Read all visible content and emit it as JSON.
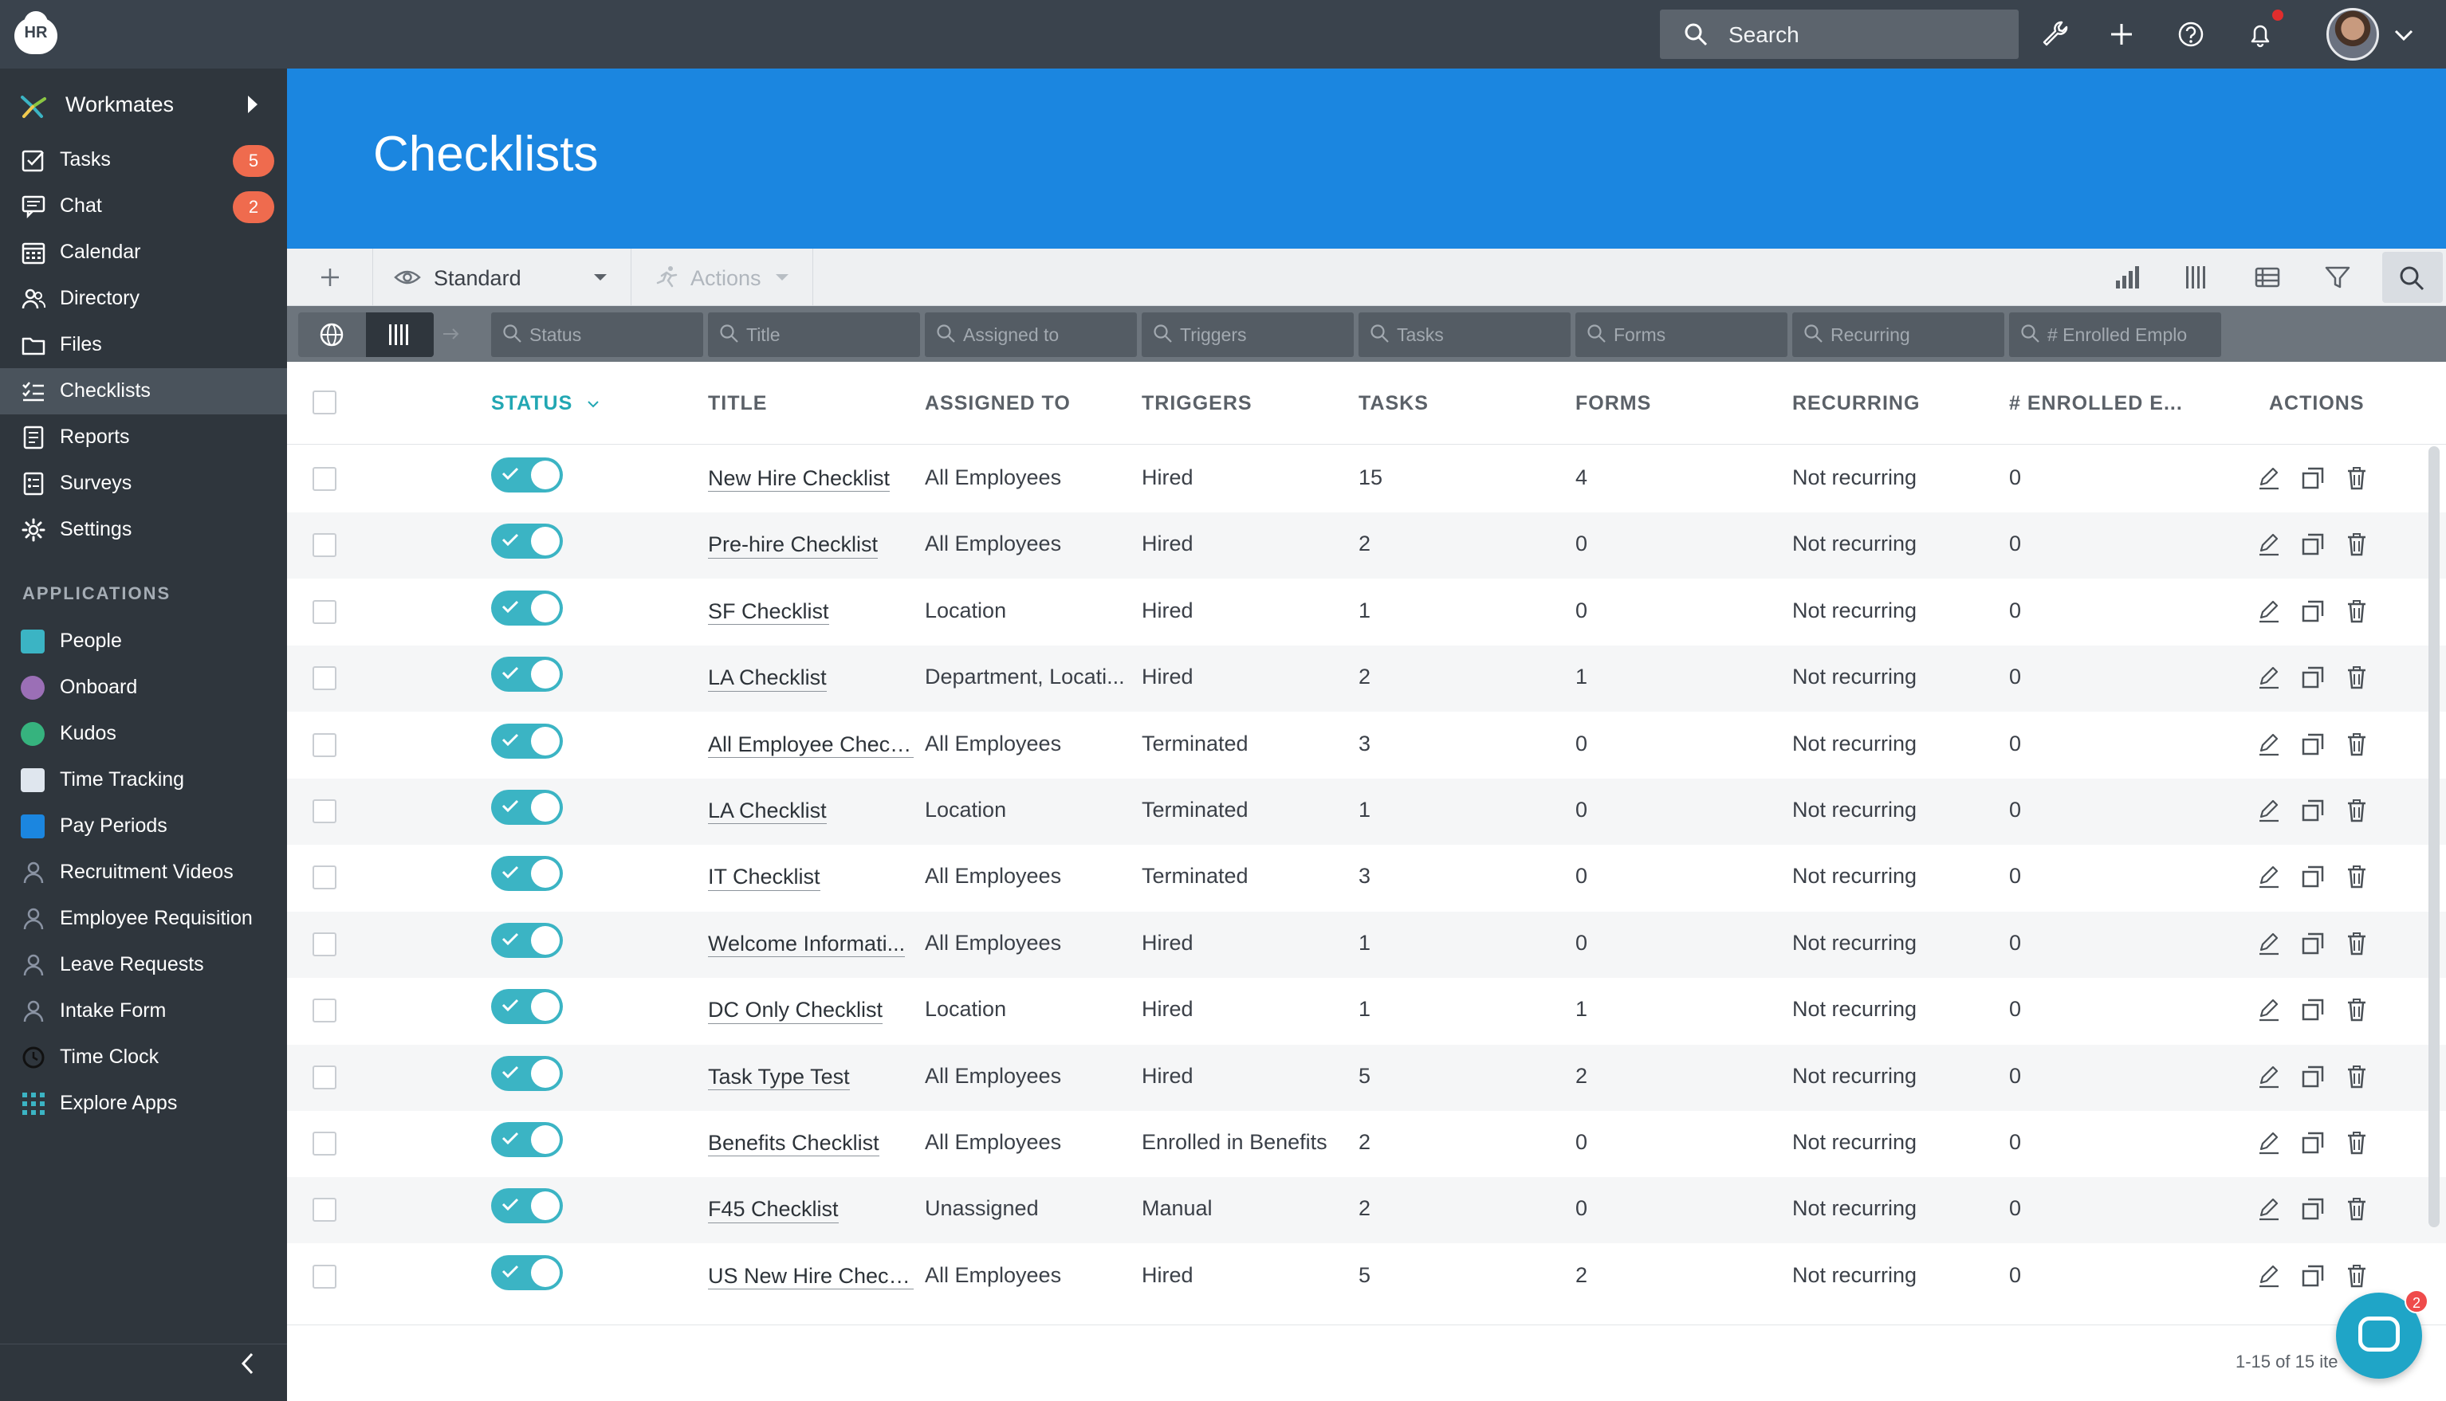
{
  "app": {
    "logo_text": "HR"
  },
  "topbar": {
    "search_label": "Search"
  },
  "sidebar": {
    "workspace": "Workmates",
    "items": [
      {
        "label": "Tasks",
        "icon": "checkbox-icon",
        "badge": "5"
      },
      {
        "label": "Chat",
        "icon": "chat-icon",
        "badge": "2"
      },
      {
        "label": "Calendar",
        "icon": "calendar-icon"
      },
      {
        "label": "Directory",
        "icon": "people-icon"
      },
      {
        "label": "Files",
        "icon": "folder-icon"
      },
      {
        "label": "Checklists",
        "icon": "checklist-icon",
        "active": true
      },
      {
        "label": "Reports",
        "icon": "report-icon"
      },
      {
        "label": "Surveys",
        "icon": "survey-icon"
      },
      {
        "label": "Settings",
        "icon": "gear-icon"
      }
    ],
    "applications_title": "APPLICATIONS",
    "apps": [
      {
        "label": "People",
        "color": "#3bb4c4"
      },
      {
        "label": "Onboard",
        "color": "#9b6fb6"
      },
      {
        "label": "Kudos",
        "color": "#36b37e"
      },
      {
        "label": "Time Tracking",
        "color": "#dfe6ee"
      },
      {
        "label": "Pay Periods",
        "color": "#1b86e0"
      },
      {
        "label": "Recruitment Videos",
        "color": "#8a93a3"
      },
      {
        "label": "Employee Requisition",
        "color": "#8a93a3"
      },
      {
        "label": "Leave Requests",
        "color": "#8a93a3"
      },
      {
        "label": "Intake Form",
        "color": "#8a93a3"
      },
      {
        "label": "Time Clock",
        "color": "#2f363d"
      },
      {
        "label": "Explore Apps",
        "color": "#3bb4c4"
      }
    ]
  },
  "page": {
    "title": "Checklists"
  },
  "toolbar": {
    "view_label": "Standard",
    "actions_label": "Actions"
  },
  "filters": {
    "placeholders": [
      "Status",
      "Title",
      "Assigned to",
      "Triggers",
      "Tasks",
      "Forms",
      "Recurring",
      "# Enrolled Emplo"
    ]
  },
  "table": {
    "columns": [
      "STATUS",
      "TITLE",
      "ASSIGNED TO",
      "TRIGGERS",
      "TASKS",
      "FORMS",
      "RECURRING",
      "# ENROLLED E...",
      "ACTIONS"
    ],
    "rows": [
      {
        "status": "on",
        "title": "New Hire Checklist",
        "assigned": "All Employees",
        "trigger": "Hired",
        "tasks": "15",
        "forms": "4",
        "recurring": "Not recurring",
        "enrolled": "0"
      },
      {
        "status": "on",
        "title": "Pre-hire Checklist",
        "assigned": "All Employees",
        "trigger": "Hired",
        "tasks": "2",
        "forms": "0",
        "recurring": "Not recurring",
        "enrolled": "0"
      },
      {
        "status": "on",
        "title": "SF Checklist",
        "assigned": "Location",
        "trigger": "Hired",
        "tasks": "1",
        "forms": "0",
        "recurring": "Not recurring",
        "enrolled": "0"
      },
      {
        "status": "on",
        "title": "LA Checklist",
        "assigned": "Department, Locati...",
        "trigger": "Hired",
        "tasks": "2",
        "forms": "1",
        "recurring": "Not recurring",
        "enrolled": "0"
      },
      {
        "status": "on",
        "title": "All Employee Check...",
        "assigned": "All Employees",
        "trigger": "Terminated",
        "tasks": "3",
        "forms": "0",
        "recurring": "Not recurring",
        "enrolled": "0"
      },
      {
        "status": "on",
        "title": "LA Checklist",
        "assigned": "Location",
        "trigger": "Terminated",
        "tasks": "1",
        "forms": "0",
        "recurring": "Not recurring",
        "enrolled": "0"
      },
      {
        "status": "on",
        "title": "IT Checklist",
        "assigned": "All Employees",
        "trigger": "Terminated",
        "tasks": "3",
        "forms": "0",
        "recurring": "Not recurring",
        "enrolled": "0"
      },
      {
        "status": "on",
        "title": "Welcome Informati...",
        "assigned": "All Employees",
        "trigger": "Hired",
        "tasks": "1",
        "forms": "0",
        "recurring": "Not recurring",
        "enrolled": "0"
      },
      {
        "status": "on",
        "title": "DC Only Checklist",
        "assigned": "Location",
        "trigger": "Hired",
        "tasks": "1",
        "forms": "1",
        "recurring": "Not recurring",
        "enrolled": "0"
      },
      {
        "status": "on",
        "title": "Task Type Test",
        "assigned": "All Employees",
        "trigger": "Hired",
        "tasks": "5",
        "forms": "2",
        "recurring": "Not recurring",
        "enrolled": "0"
      },
      {
        "status": "on",
        "title": "Benefits Checklist",
        "assigned": "All Employees",
        "trigger": "Enrolled in Benefits",
        "tasks": "2",
        "forms": "0",
        "recurring": "Not recurring",
        "enrolled": "0"
      },
      {
        "status": "on",
        "title": "F45 Checklist",
        "assigned": "Unassigned",
        "trigger": "Manual",
        "tasks": "2",
        "forms": "0",
        "recurring": "Not recurring",
        "enrolled": "0"
      },
      {
        "status": "on",
        "title": "US New Hire Check...",
        "assigned": "All Employees",
        "trigger": "Hired",
        "tasks": "5",
        "forms": "2",
        "recurring": "Not recurring",
        "enrolled": "0"
      }
    ]
  },
  "footer": {
    "pagination": "1-15 of 15 ite",
    "chat_badge": "2"
  },
  "colors": {
    "header_blue": "#1b86e0",
    "toggle_teal": "#3bb4c4",
    "badge_orange": "#ef6b4e",
    "sidebar_bg": "#2f363d"
  }
}
